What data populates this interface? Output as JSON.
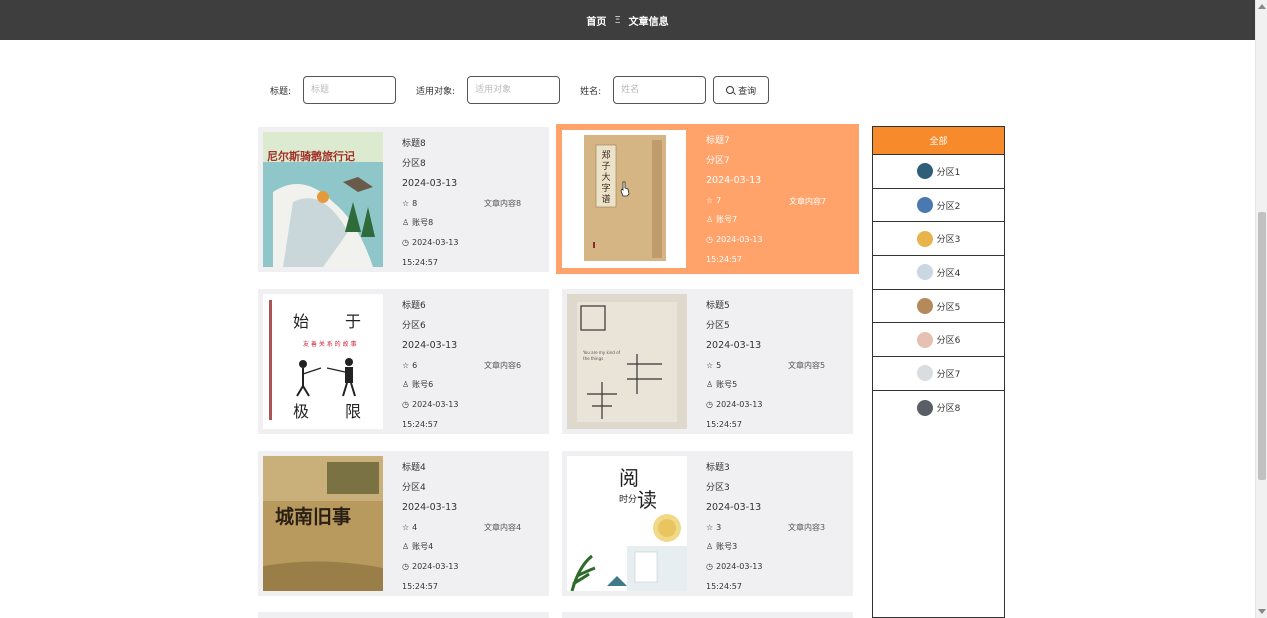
{
  "nav": {
    "home": "首页",
    "separator": "Ξ",
    "current": "文章信息"
  },
  "search": {
    "fields": [
      {
        "label": "标题:",
        "placeholder": "标题"
      },
      {
        "label": "适用对象:",
        "placeholder": "适用对象"
      },
      {
        "label": "姓名:",
        "placeholder": "姓名"
      }
    ],
    "button_label": "查询"
  },
  "cards": [
    {
      "title": "标题8",
      "zone": "分区8",
      "date": "2024-03-13",
      "stars": "8",
      "account": "账号8",
      "time_date": "2024-03-13",
      "time": "15:24:57",
      "content": "文章内容8",
      "active": false
    },
    {
      "title": "标题7",
      "zone": "分区7",
      "date": "2024-03-13",
      "stars": "7",
      "account": "账号7",
      "time_date": "2024-03-13",
      "time": "15:24:57",
      "content": "文章内容7",
      "active": true
    },
    {
      "title": "标题6",
      "zone": "分区6",
      "date": "2024-03-13",
      "stars": "6",
      "account": "账号6",
      "time_date": "2024-03-13",
      "time": "15:24:57",
      "content": "文章内容6",
      "active": false
    },
    {
      "title": "标题5",
      "zone": "分区5",
      "date": "2024-03-13",
      "stars": "5",
      "account": "账号5",
      "time_date": "2024-03-13",
      "time": "15:24:57",
      "content": "文章内容5",
      "active": false
    },
    {
      "title": "标题4",
      "zone": "分区4",
      "date": "2024-03-13",
      "stars": "4",
      "account": "账号4",
      "time_date": "2024-03-13",
      "time": "15:24:57",
      "content": "文章内容4",
      "active": false
    },
    {
      "title": "标题3",
      "zone": "分区3",
      "date": "2024-03-13",
      "stars": "3",
      "account": "账号3",
      "time_date": "2024-03-13",
      "time": "15:24:57",
      "content": "文章内容3",
      "active": false
    }
  ],
  "covers": {
    "book8": "尼尔斯骑鹅旅行记",
    "book6": [
      "始",
      "于",
      "极",
      "限"
    ],
    "book4": "城南旧事",
    "book3": [
      "阅",
      "读",
      "时分"
    ]
  },
  "sidebar": {
    "all_label": "全部",
    "items": [
      {
        "label": "分区1",
        "color": "#2e5e7a"
      },
      {
        "label": "分区2",
        "color": "#4a78b0"
      },
      {
        "label": "分区3",
        "color": "#e8b34b"
      },
      {
        "label": "分区4",
        "color": "#c9d6e3"
      },
      {
        "label": "分区5",
        "color": "#b58a5a"
      },
      {
        "label": "分区6",
        "color": "#e7c0b4"
      },
      {
        "label": "分区7",
        "color": "#d9dde0"
      },
      {
        "label": "分区8",
        "color": "#5a5e66"
      }
    ]
  },
  "colors": {
    "topbar": "#3e3e3e",
    "active_card": "#ffa36b",
    "accent": "#f78b2b"
  }
}
